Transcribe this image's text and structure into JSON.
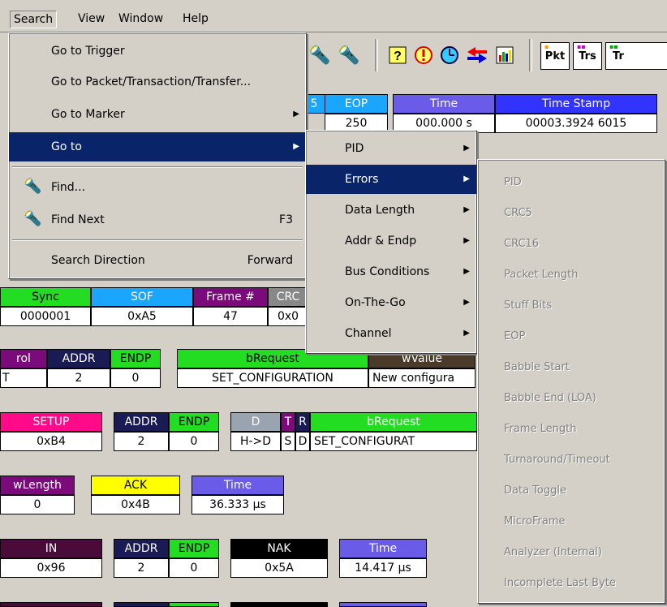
{
  "menubar": {
    "items": [
      "Search",
      "View",
      "Window",
      "Help"
    ]
  },
  "toolbar": {
    "icons": [
      "find-icon",
      "find-next-icon",
      "help-icon",
      "error-icon",
      "clock-icon",
      "arrows-icon",
      "chart-icon"
    ],
    "buttons": [
      "Pkt",
      "Trs",
      "Tr"
    ]
  },
  "trace": {
    "row0": {
      "headers": [
        "5",
        "EOP",
        "Time",
        "Time Stamp"
      ],
      "values": [
        "250",
        "000.000 s",
        "00003.3924 6015"
      ]
    },
    "row1": {
      "headers": [
        "Sync",
        "SOF",
        "Frame #",
        "CRC"
      ],
      "values": [
        "0000001",
        "0xA5",
        "47",
        "0x0"
      ]
    },
    "row2": {
      "headers": [
        "rol",
        "ADDR",
        "ENDP",
        "bRequest",
        "wValue"
      ],
      "values": [
        "T",
        "2",
        "0",
        "SET_CONFIGURATION",
        "New configura"
      ]
    },
    "row3": {
      "headers": [
        "SETUP",
        "ADDR",
        "ENDP",
        "D",
        "T",
        "R",
        "bRequest"
      ],
      "values": [
        "0xB4",
        "2",
        "0",
        "H->D",
        "S",
        "D",
        "SET_CONFIGURAT"
      ]
    },
    "row4": {
      "headers": [
        "wLength",
        "ACK",
        "Time"
      ],
      "values": [
        "0",
        "0x4B",
        "36.333 µs"
      ]
    },
    "row5": {
      "headers": [
        "IN",
        "ADDR",
        "ENDP",
        "NAK",
        "Time"
      ],
      "values": [
        "0x96",
        "2",
        "0",
        "0x5A",
        "14.417 µs"
      ]
    }
  },
  "search_menu": {
    "items": [
      {
        "label": "Go to Trigger"
      },
      {
        "label": "Go to Packet/Transaction/Transfer..."
      },
      {
        "label": "Go to Marker"
      },
      {
        "label": "Go to"
      },
      {
        "label": "Find..."
      },
      {
        "label": "Find Next",
        "shortcut": "F3"
      },
      {
        "label": "Search Direction",
        "shortcut": "Forward"
      }
    ]
  },
  "goto_menu": {
    "items": [
      "PID",
      "Errors",
      "Data Length",
      "Addr & Endp",
      "Bus Conditions",
      "On-The-Go",
      "Channel"
    ]
  },
  "errors_menu": {
    "items": [
      "PID",
      "CRC5",
      "CRC16",
      "Packet Length",
      "Stuff Bits",
      "EOP",
      "Babble Start",
      "Babble End (LOA)",
      "Frame Length",
      "Turnaround/Timeout",
      "Data Toggle",
      "MicroFrame",
      "Analyzer (Internal)",
      "Incomplete Last Byte"
    ]
  },
  "colors": {
    "menu_highlight": "#0a246a",
    "header_blue": "#3333ff",
    "header_purple": "#7b0a7b",
    "header_green": "#22dd22",
    "header_pink": "#ff0b8a",
    "header_navy": "#1a1a55",
    "header_yellow": "#ffff00",
    "header_cyan": "#1aa5ff",
    "header_periwinkle": "#6a5ce8"
  }
}
